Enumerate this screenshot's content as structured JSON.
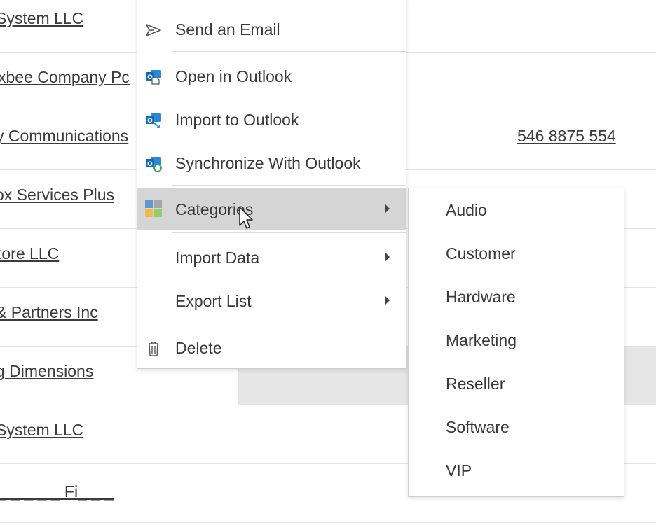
{
  "list": {
    "rows": [
      {
        "company": "System LLC",
        "phone": ""
      },
      {
        "company": "xbee Company Pc",
        "phone": ""
      },
      {
        "company": "y Communications",
        "phone": "546 8875 554"
      },
      {
        "company": "ox Services Plus",
        "phone": ""
      },
      {
        "company": "tore LLC",
        "phone": ""
      },
      {
        "company": "& Partners Inc",
        "phone": ""
      },
      {
        "company": "g Dimensions",
        "phone": ""
      },
      {
        "company": "System LLC",
        "phone": ""
      },
      {
        "company": "_ _ _ _ _ Fi_ _ _",
        "phone": ""
      }
    ]
  },
  "menu": {
    "items": [
      {
        "label": "Send an Email",
        "icon": "send-icon"
      },
      {
        "label": "Open in Outlook",
        "icon": "outlook-open-icon"
      },
      {
        "label": "Import to Outlook",
        "icon": "outlook-import-icon"
      },
      {
        "label": "Synchronize With Outlook",
        "icon": "outlook-sync-icon"
      },
      {
        "label": "Categories",
        "icon": "categories-icon"
      },
      {
        "label": "Import Data",
        "icon": ""
      },
      {
        "label": "Export List",
        "icon": ""
      },
      {
        "label": "Delete",
        "icon": "trash-icon"
      }
    ]
  },
  "submenu": {
    "items": [
      "Audio",
      "Customer",
      "Hardware",
      "Marketing",
      "Reseller",
      "Software",
      "VIP"
    ]
  },
  "colors": {
    "outlook_blue": "#0f6cbd",
    "hover_gray": "#d5d5d5",
    "row_highlight": "#e6e6e6"
  }
}
